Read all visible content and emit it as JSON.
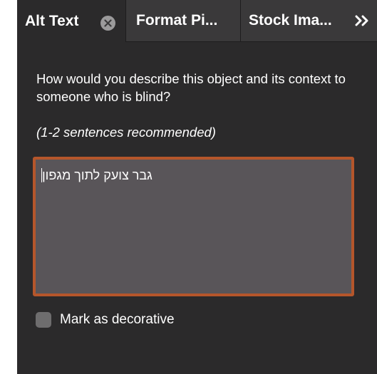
{
  "tabs": [
    {
      "label": "Alt Text",
      "active": true,
      "closable": true
    },
    {
      "label": "Format Pi...",
      "active": false
    },
    {
      "label": "Stock Ima...",
      "active": false
    }
  ],
  "tab_close_icon": "close-circle-icon",
  "overflow_icon": "double-chevron-right-icon",
  "alt_text_pane": {
    "prompt": "How would you describe this object and its context to someone who is blind?",
    "hint": "(1-2 sentences recommended)",
    "description_value": "גבר צועק לתוך מגפון",
    "decorative_label": "Mark as decorative",
    "decorative_checked": false
  },
  "colors": {
    "panel_bg": "#2b2a2b",
    "tabbar_bg": "#3a393a",
    "textarea_bg": "#595559",
    "focus_border": "#b5562b"
  }
}
